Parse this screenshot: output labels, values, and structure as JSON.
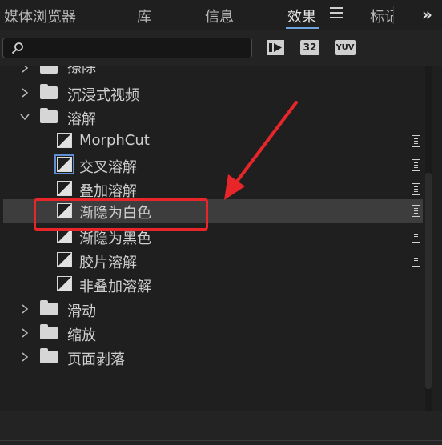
{
  "tabs": [
    {
      "label": "媒体浏览器"
    },
    {
      "label": "库"
    },
    {
      "label": "信息"
    },
    {
      "label": "效果",
      "active": true
    },
    {
      "label": "标记"
    }
  ],
  "more_label": "»",
  "search": {
    "value": "",
    "placeholder": ""
  },
  "toolbar_badges": [
    "32",
    "YUV"
  ],
  "tree": {
    "clipped_item": "擦除",
    "folders_top": [
      "沉浸式视频",
      "溶解"
    ],
    "dissolve_items": [
      "MorphCut",
      "交叉溶解",
      "叠加溶解",
      "渐隐为白色",
      "渐隐为黑色",
      "胶片溶解",
      "非叠加溶解"
    ],
    "folders_bottom": [
      "滑动",
      "缩放",
      "页面剥落"
    ]
  },
  "selected_item": "渐隐为白色",
  "annotation_color": "#e8262a"
}
